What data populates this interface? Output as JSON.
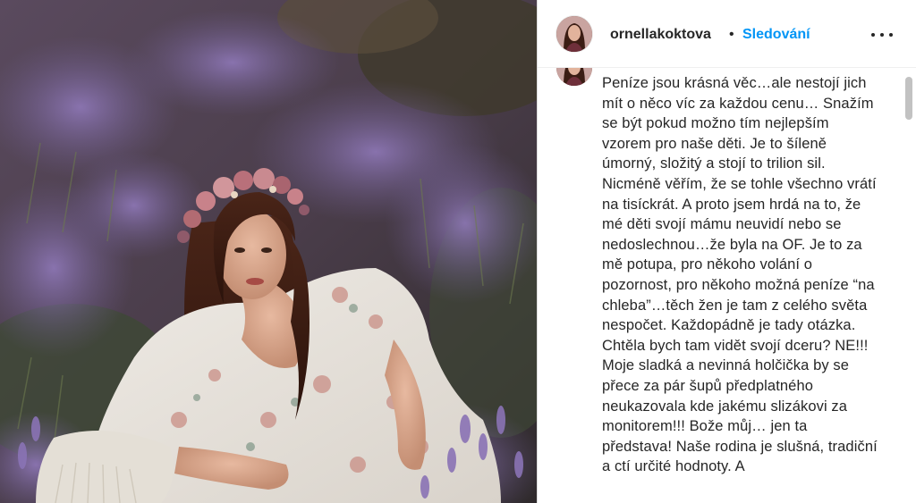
{
  "post": {
    "photo_icon": "photo-of-woman-in-lavender-field"
  },
  "header": {
    "username": "ornellakoktova",
    "separator": "•",
    "follow_label": "Sledování",
    "more_icon": "more-horizontal-icon"
  },
  "caption": {
    "text": "Peníze jsou krásná věc…ale nestojí jich mít o něco víc za každou cenu… Snažím se být pokud možno tím nejlepším vzorem pro naše děti. Je to šíleně úmorný, složitý a stojí to trilion sil. Nicméně věřím, že se tohle všechno vrátí na tisíckrát. A proto jsem hrdá na to, že mé děti svojí mámu neuvidí nebo se nedoslechnou…že byla na OF. Je to za mě potupa, pro někoho volání o pozornost, pro někoho možná peníze “na chleba”…těch žen je tam z celého světa nespočet. Každopádně je tady otázka. Chtěla bych tam vidět svojí dceru? NE!!! Moje sladká a nevinná holčička by se přece za pár šupů předplatného neukazovala kde jakému slizákovi za monitorem!!! Bože můj… jen ta představa! Naše rodina je slušná, tradiční a ctí určité hodnoty. A"
  },
  "colors": {
    "follow": "#0095f6",
    "text": "#262626",
    "divider": "#efefef"
  }
}
